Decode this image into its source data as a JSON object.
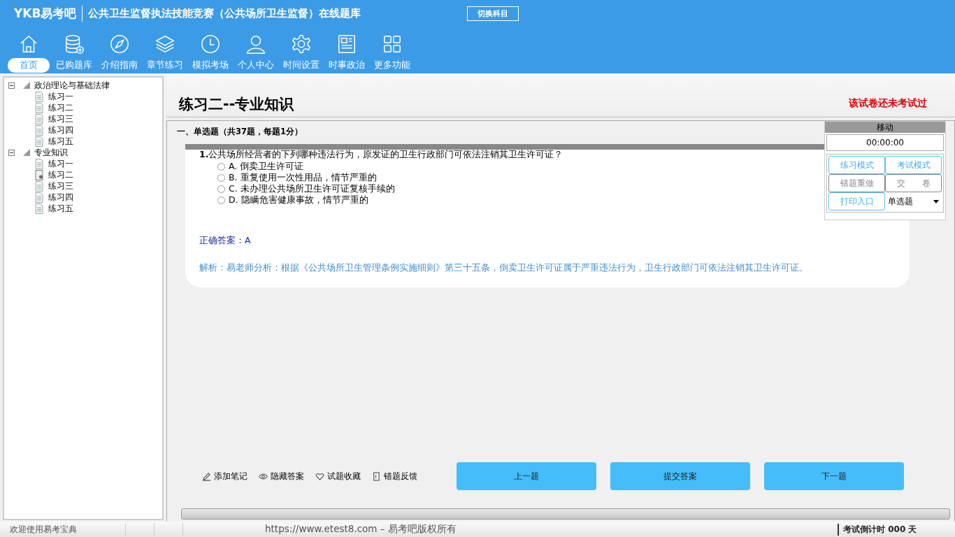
{
  "header": {
    "logo": "YKB易考吧",
    "title": "公共卫生监督执法技能竞赛（公共场所卫生监督）在线题库",
    "switch_button": "切换科目"
  },
  "nav": [
    {
      "label": "首页",
      "kind": "home",
      "selected": true
    },
    {
      "label": "已购题库",
      "kind": "database",
      "selected": false
    },
    {
      "label": "介绍指南",
      "kind": "compass",
      "selected": false
    },
    {
      "label": "章节练习",
      "kind": "layers",
      "selected": false
    },
    {
      "label": "模拟考场",
      "kind": "clock",
      "selected": false
    },
    {
      "label": "个人中心",
      "kind": "user",
      "selected": false
    },
    {
      "label": "时间设置",
      "kind": "gear",
      "selected": false
    },
    {
      "label": "时事政治",
      "kind": "news",
      "selected": false
    },
    {
      "label": "更多功能",
      "kind": "grid",
      "selected": false
    }
  ],
  "tree": [
    {
      "label": "政治理论与基础法律",
      "expanded": true,
      "children": [
        {
          "label": "练习一",
          "selected": false
        },
        {
          "label": "练习二",
          "selected": false
        },
        {
          "label": "练习三",
          "selected": false
        },
        {
          "label": "练习四",
          "selected": false
        },
        {
          "label": "练习五",
          "selected": false
        }
      ]
    },
    {
      "label": "专业知识",
      "expanded": true,
      "children": [
        {
          "label": "练习一",
          "selected": false
        },
        {
          "label": "练习二",
          "selected": true
        },
        {
          "label": "练习三",
          "selected": false
        },
        {
          "label": "练习四",
          "selected": false
        },
        {
          "label": "练习五",
          "selected": false
        }
      ]
    }
  ],
  "paper": {
    "title": "练习二--专业知识",
    "status": "该试卷还未考试过"
  },
  "section": "一、单选题（共37题，每题1分）",
  "question": {
    "number": "1.",
    "text": "公共场所经营者的下列哪种违法行为，原发证的卫生行政部门可依法注销其卫生许可证？",
    "options": [
      {
        "label": "A.",
        "text": "倒卖卫生许可证",
        "selected": false
      },
      {
        "label": "B.",
        "text": "重复使用一次性用品，情节严重的",
        "selected": false
      },
      {
        "label": "C.",
        "text": "未办理公共场所卫生许可证复核手续的",
        "selected": false
      },
      {
        "label": "D.",
        "text": "隐瞒危害健康事故，情节严重的",
        "selected": false
      }
    ],
    "answer": "正确答案：A",
    "analysis": "解析：易老师分析：根据《公共场所卫生管理条例实施细则》第三十五条，倒卖卫生许可证属于严重违法行为，卫生行政部门可依法注销其卫生许可证。"
  },
  "panel": {
    "title": "移动",
    "timer": "00:00:00",
    "buttons": [
      {
        "label": "练习模式",
        "disabled": false
      },
      {
        "label": "考试模式",
        "disabled": false
      },
      {
        "label": "错题重做",
        "disabled": true
      },
      {
        "label": "交　　卷",
        "disabled": true
      },
      {
        "label": "打印入口",
        "disabled": false
      }
    ],
    "type_select": "单选题"
  },
  "tools": [
    {
      "label": "添加笔记",
      "kind": "pencil"
    },
    {
      "label": "隐藏答案",
      "kind": "eye"
    },
    {
      "label": "试题收藏",
      "kind": "heart"
    },
    {
      "label": "错题反馈",
      "kind": "doc"
    }
  ],
  "nav_buttons": [
    "上一题",
    "提交答案",
    "下一题"
  ],
  "status_bar": {
    "welcome": "欢迎使用易考宝典",
    "copyright": "https://www.etest8.com – 易考吧版权所有",
    "countdown": "考试倒计时 000 天"
  }
}
